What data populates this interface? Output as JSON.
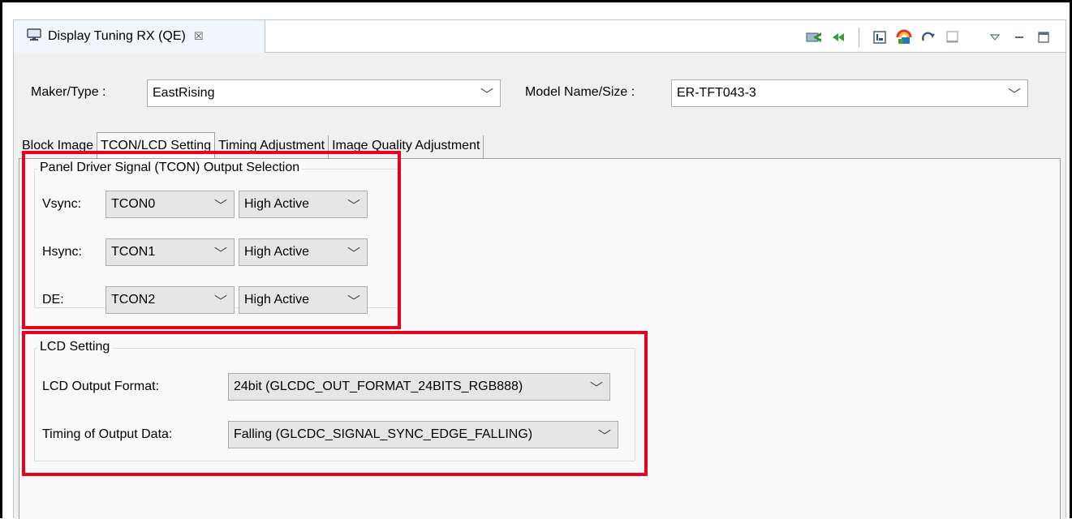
{
  "view": {
    "title": "Display Tuning RX (QE)",
    "close_glyph": "☒",
    "icon": "monitor-icon"
  },
  "toolbar": {
    "icons": [
      "export-icon",
      "rewind-icon",
      "report-icon",
      "palette-icon",
      "refresh-icon",
      "panel-icon",
      "view-menu-icon",
      "minimize-icon",
      "maximize-icon"
    ]
  },
  "header": {
    "maker_label": "Maker/Type :",
    "maker_value": "EastRising",
    "model_label": "Model Name/Size :",
    "model_value": "ER-TFT043-3"
  },
  "tabs": [
    {
      "label": "Block Image",
      "active": false
    },
    {
      "label": "TCON/LCD Setting",
      "active": true
    },
    {
      "label": "Timing Adjustment",
      "active": false
    },
    {
      "label": "Image Quality Adjustment",
      "active": false
    }
  ],
  "tcon_group": {
    "title": "Panel Driver Signal (TCON) Output Selection",
    "rows": [
      {
        "label": "Vsync:",
        "tcon": "TCON0",
        "polarity": "High Active"
      },
      {
        "label": "Hsync:",
        "tcon": "TCON1",
        "polarity": "High Active"
      },
      {
        "label": "DE:",
        "tcon": "TCON2",
        "polarity": "High Active"
      }
    ]
  },
  "lcd_group": {
    "title": "LCD Setting",
    "output_format_label": "LCD Output Format:",
    "output_format_value": "24bit (GLCDC_OUT_FORMAT_24BITS_RGB888)",
    "timing_label": "Timing of Output Data:",
    "timing_value": "Falling (GLCDC_SIGNAL_SYNC_EDGE_FALLING)"
  },
  "colors": {
    "highlight": "#e8001c",
    "pane_bg": "#f9f9f9",
    "window_bg": "#f0f0f0"
  },
  "chevron": "﹀"
}
